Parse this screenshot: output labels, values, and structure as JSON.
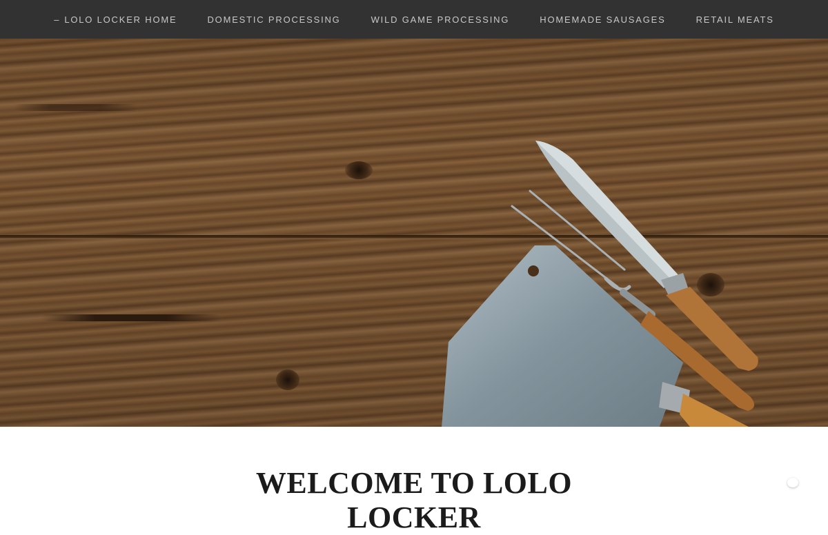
{
  "nav": {
    "items": [
      {
        "label": "LOLO LOCKER HOME",
        "prefix": "–",
        "active": true
      },
      {
        "label": "DOMESTIC PROCESSING"
      },
      {
        "label": "WILD GAME PROCESSING"
      },
      {
        "label": "HOMEMADE SAUSAGES"
      },
      {
        "label": "RETAIL MEATS"
      }
    ]
  },
  "hero": {
    "image": "knives-on-rustic-wood",
    "icons": [
      "cleaver-icon",
      "carving-fork-icon",
      "butcher-knife-icon"
    ]
  },
  "main": {
    "heading_line1": "WELCOME TO LOLO",
    "heading_line2": "LOCKER"
  },
  "colors": {
    "nav_bg": "#323232",
    "nav_text": "#c9c9c9",
    "heading": "#1b1b1b"
  }
}
